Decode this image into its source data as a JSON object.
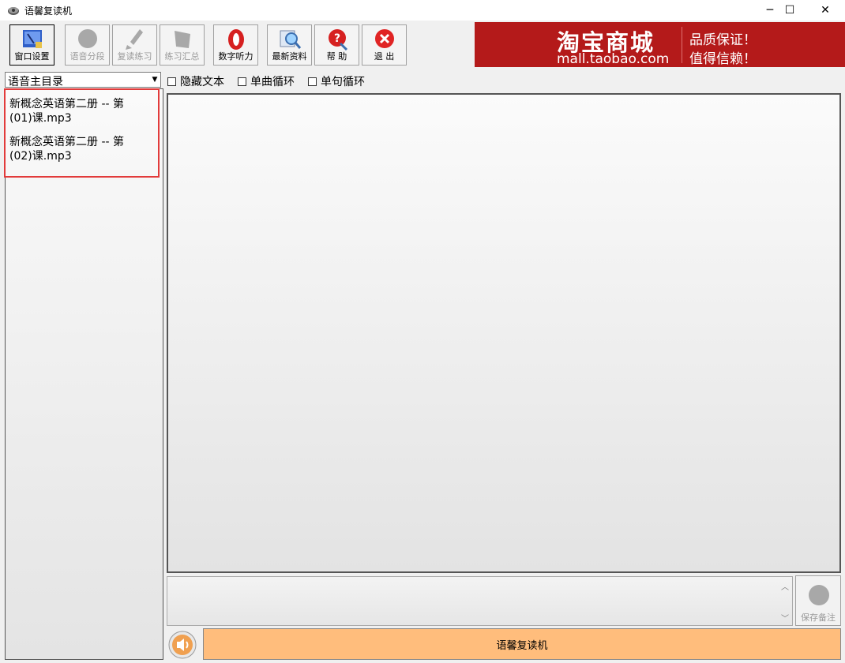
{
  "window": {
    "title": "语馨复读机",
    "minimize_glyph": "─",
    "maximize_glyph": "☐",
    "close_glyph": "✕"
  },
  "toolbar": {
    "buttons": [
      {
        "label": "窗口设置",
        "icon": "window-settings-icon",
        "enabled": true
      },
      {
        "label": "语音分段",
        "icon": "audio-segment-icon",
        "enabled": false
      },
      {
        "label": "复读练习",
        "icon": "repeat-practice-icon",
        "enabled": false
      },
      {
        "label": "练习汇总",
        "icon": "practice-summary-icon",
        "enabled": false
      },
      {
        "label": "数字听力",
        "icon": "digit-listening-icon",
        "enabled": true
      },
      {
        "label": "最新资料",
        "icon": "latest-materials-icon",
        "enabled": true
      },
      {
        "label": "帮 助",
        "icon": "help-icon",
        "enabled": true
      },
      {
        "label": "退 出",
        "icon": "exit-icon",
        "enabled": true
      }
    ]
  },
  "banner": {
    "logo": "淘宝商城",
    "url": "mall.taobao.com",
    "slogan1": "品质保证！",
    "slogan2": "值得信赖！",
    "bg_color": "#b41a1a"
  },
  "directory": {
    "selected": "语音主目录",
    "files": [
      {
        "line1": "新概念英语第二册 -- 第",
        "line2": "(01)课.mp3"
      },
      {
        "line1": "新概念英语第二册 -- 第",
        "line2": "(02)课.mp3"
      }
    ]
  },
  "options": {
    "hide_text": "隐藏文本",
    "single_track_loop": "单曲循环",
    "single_sentence_loop": "单句循环"
  },
  "notes": {
    "save_label": "保存备注"
  },
  "player": {
    "label": "语馨复读机",
    "bar_color": "#ffbd7c"
  }
}
